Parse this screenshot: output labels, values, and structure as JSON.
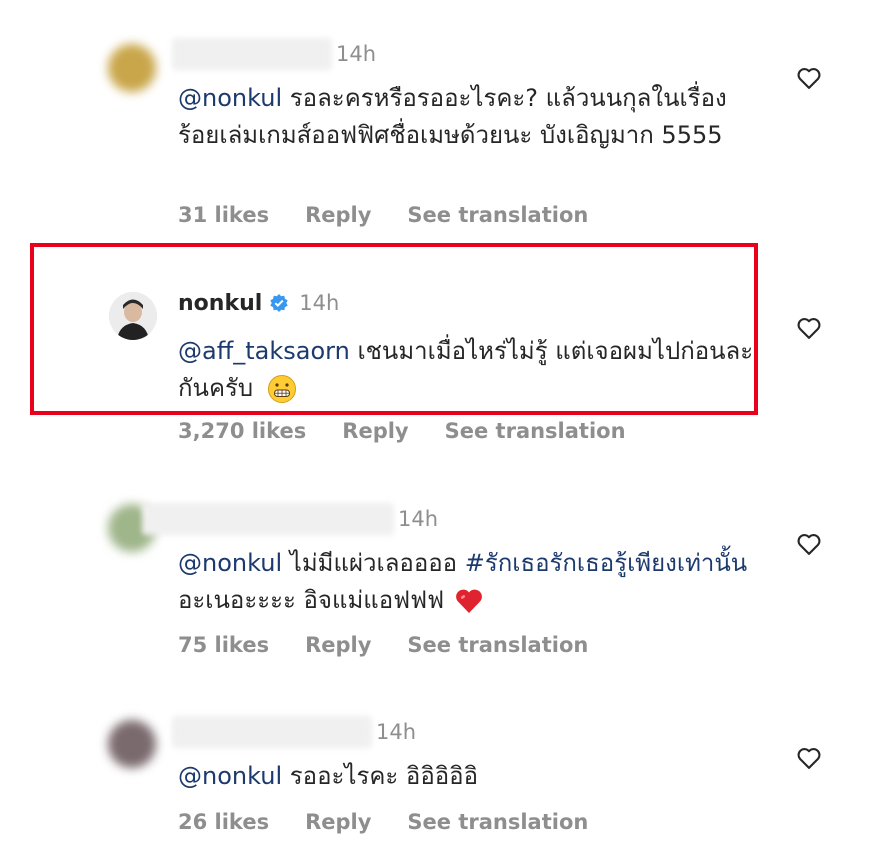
{
  "comments": [
    {
      "time": "14h",
      "mention": "@nonkul",
      "text": " รอละครหรือรออะไรคะ? แล้วนนกุลในเรื่องร้อยเล่มเกมส์ออฟฟิศชื่อเมษด้วยนะ บังเอิญมาก 5555",
      "likes": "31 likes",
      "reply": "Reply",
      "translate": "See translation"
    },
    {
      "username": "nonkul",
      "time": "14h",
      "mention": "@aff_taksaorn",
      "text": " เชนมาเมื่อไหร่ไม่รู้ แต่เจอผมไปก่อนละกันครับ",
      "likes": "3,270 likes",
      "reply": "Reply",
      "translate": "See translation"
    },
    {
      "time": "14h",
      "mention": "@nonkul",
      "text_before_tag": " ไม่มีแผ่วเลออออ ",
      "hashtag": "#รักเธอรักเธอรู้เพียงเท่านั้น",
      "text_after_tag": "  อะเนอะะะะ อิจแม่แอฟฟฟ",
      "likes": "75 likes",
      "reply": "Reply",
      "translate": "See translation"
    },
    {
      "time": "14h",
      "mention": "@nonkul",
      "text": " รออะไรคะ อิอิอิอิอิ",
      "likes": "26 likes",
      "reply": "Reply",
      "translate": "See translation"
    }
  ],
  "colors": {
    "highlight_border": "#e8001c",
    "mention": "#1d3a6e",
    "verified": "#3897f0"
  },
  "icons": [
    "heart-outline-icon",
    "verified-badge-icon",
    "grimace-emoji-icon",
    "red-heart-emoji-icon"
  ]
}
